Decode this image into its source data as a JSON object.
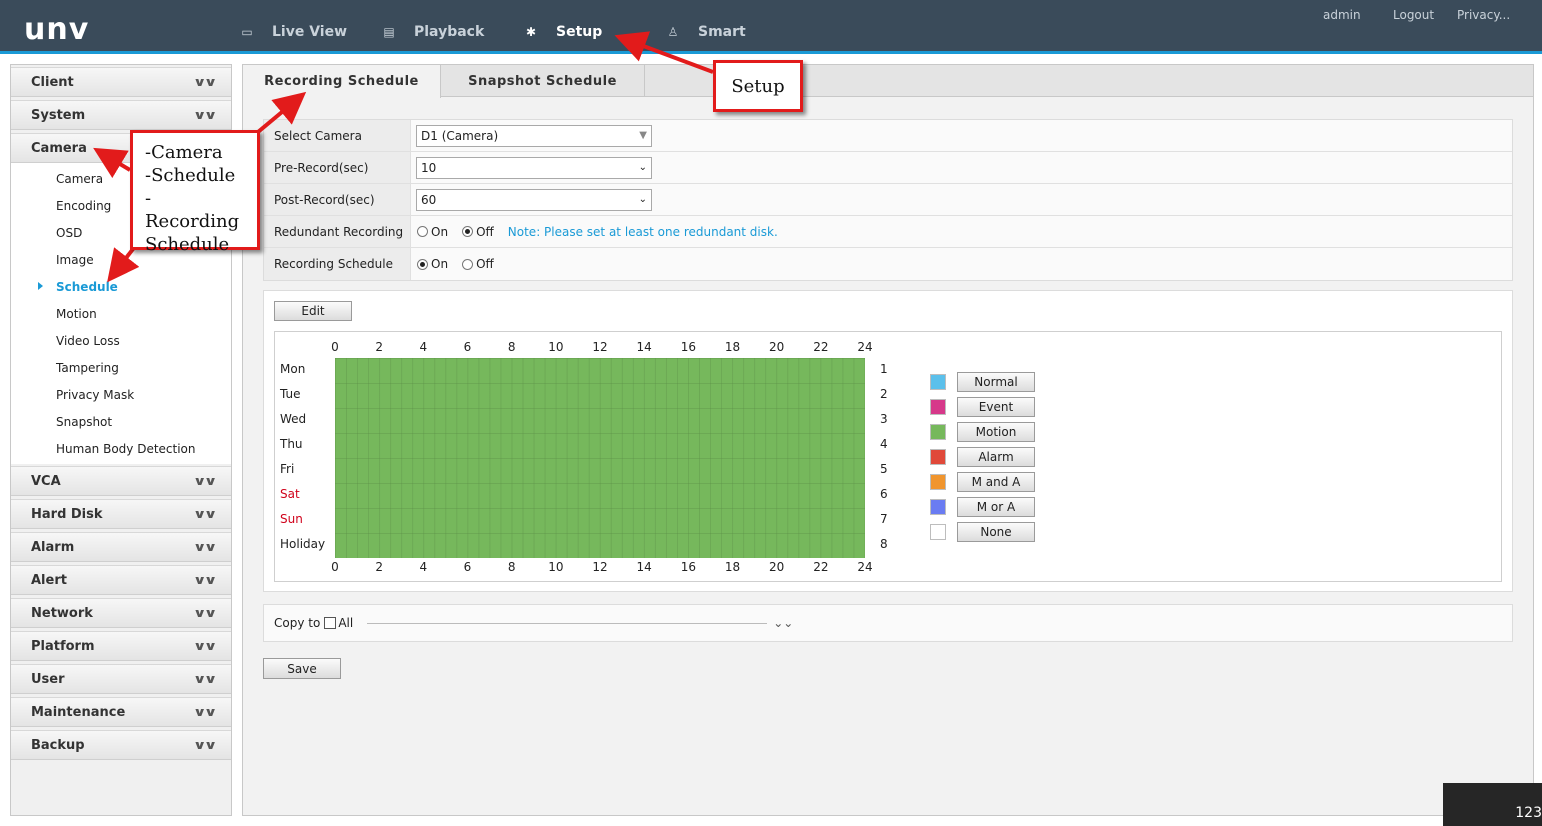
{
  "header": {
    "logo": "unv",
    "nav": [
      {
        "label": "Live View",
        "icon": "monitor-icon"
      },
      {
        "label": "Playback",
        "icon": "film-icon"
      },
      {
        "label": "Setup",
        "icon": "gear-icon"
      },
      {
        "label": "Smart",
        "icon": "person-search-icon"
      }
    ],
    "active_nav": "Setup",
    "links": {
      "admin": "admin",
      "logout": "Logout",
      "privacy": "Privacy..."
    }
  },
  "sidebar": {
    "sections": [
      {
        "label": "Client"
      },
      {
        "label": "System"
      },
      {
        "label": "Camera"
      },
      {
        "label": "VCA"
      },
      {
        "label": "Hard Disk"
      },
      {
        "label": "Alarm"
      },
      {
        "label": "Alert"
      },
      {
        "label": "Network"
      },
      {
        "label": "Platform"
      },
      {
        "label": "User"
      },
      {
        "label": "Maintenance"
      },
      {
        "label": "Backup"
      }
    ],
    "camera_items": [
      "Camera",
      "Encoding",
      "OSD",
      "Image",
      "Schedule",
      "Motion",
      "Video Loss",
      "Tampering",
      "Privacy Mask",
      "Snapshot",
      "Human Body Detection"
    ],
    "active_item": "Schedule"
  },
  "tabs": [
    "Recording Schedule",
    "Snapshot Schedule"
  ],
  "active_tab": "Recording Schedule",
  "form": {
    "select_camera": {
      "label": "Select Camera",
      "value": "D1 (Camera)"
    },
    "pre_record": {
      "label": "Pre-Record(sec)",
      "value": "10"
    },
    "post_record": {
      "label": "Post-Record(sec)",
      "value": "60"
    },
    "redundant": {
      "label": "Redundant Recording",
      "on": "On",
      "off": "Off",
      "selected": "Off",
      "note": "Note: Please set at least one redundant disk."
    },
    "recording_schedule": {
      "label": "Recording Schedule",
      "on": "On",
      "off": "Off",
      "selected": "On"
    }
  },
  "schedule": {
    "edit_label": "Edit",
    "hours": [
      "0",
      "2",
      "4",
      "6",
      "8",
      "10",
      "12",
      "14",
      "16",
      "18",
      "20",
      "22",
      "24"
    ],
    "days": [
      {
        "name": "Mon",
        "index": "1",
        "weekend": false
      },
      {
        "name": "Tue",
        "index": "2",
        "weekend": false
      },
      {
        "name": "Wed",
        "index": "3",
        "weekend": false
      },
      {
        "name": "Thu",
        "index": "4",
        "weekend": false
      },
      {
        "name": "Fri",
        "index": "5",
        "weekend": false
      },
      {
        "name": "Sat",
        "index": "6",
        "weekend": true
      },
      {
        "name": "Sun",
        "index": "7",
        "weekend": true
      },
      {
        "name": "Holiday",
        "index": "8",
        "weekend": false
      }
    ],
    "fill_type": "Motion",
    "fill_color": "#76b85c",
    "legend": [
      {
        "label": "Normal",
        "color": "#5bc0eb"
      },
      {
        "label": "Event",
        "color": "#d6388a"
      },
      {
        "label": "Motion",
        "color": "#76b85c"
      },
      {
        "label": "Alarm",
        "color": "#e0493a"
      },
      {
        "label": "M and A",
        "color": "#f0952e"
      },
      {
        "label": "M or A",
        "color": "#6a7cf2"
      },
      {
        "label": "None",
        "color": "#ffffff"
      }
    ]
  },
  "copy": {
    "label": "Copy to",
    "all_label": "All"
  },
  "save_label": "Save",
  "annotations": {
    "setup_callout": "Setup",
    "path_callout": [
      "-Camera",
      "-Schedule",
      "-Recording",
      "Schedule"
    ],
    "accent": "#e21b1b"
  },
  "corner_text": "123"
}
